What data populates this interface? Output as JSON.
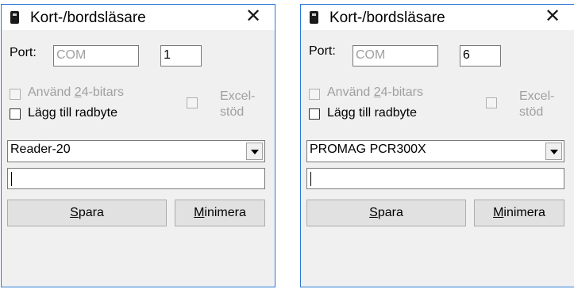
{
  "windows": [
    {
      "title": "Kort-/bordsläsare",
      "port_label": "Port:",
      "port_type": "COM",
      "port_number": "1",
      "use24_pre": "Använd ",
      "use24_key": "2",
      "use24_post": "4-bitars",
      "newline_label": "Lägg till radbyte",
      "excel_line1": "Excel-",
      "excel_line2": "stöd",
      "reader": "Reader-20",
      "input_value": "",
      "save_key": "S",
      "save_rest": "para",
      "min_key": "M",
      "min_rest": "inimera"
    },
    {
      "title": "Kort-/bordsläsare",
      "port_label": "Port:",
      "port_type": "COM",
      "port_number": "6",
      "use24_pre": "Använd ",
      "use24_key": "2",
      "use24_post": "4-bitars",
      "newline_label": "Lägg till radbyte",
      "excel_line1": "Excel-",
      "excel_line2": "stöd",
      "reader": "PROMAG PCR300X",
      "input_value": "",
      "save_key": "S",
      "save_rest": "para",
      "min_key": "M",
      "min_rest": "inimera"
    }
  ],
  "colors": {
    "accent": "#2b79d7",
    "window_bg": "#f0f0f0",
    "disabled_text": "#a0a0a0"
  },
  "icons": {
    "app": "card-reader-icon",
    "close": "close-icon",
    "dropdown": "chevron-down-icon"
  }
}
